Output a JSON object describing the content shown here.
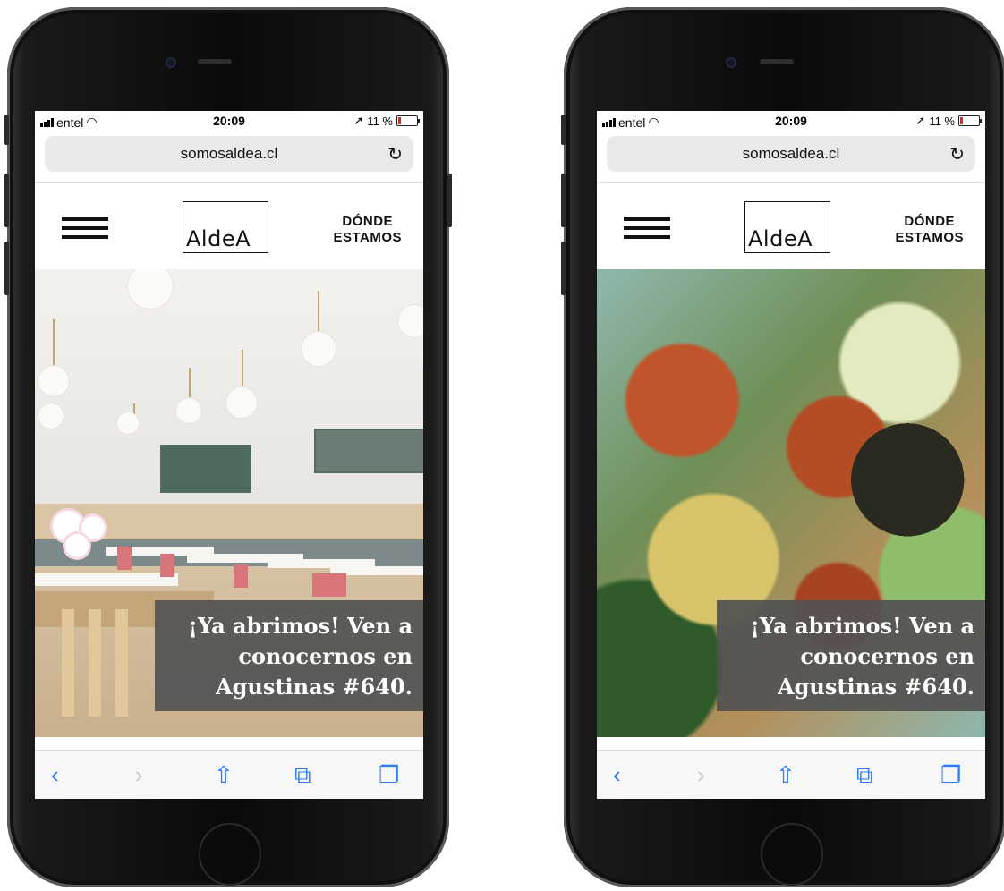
{
  "phones": [
    {
      "status": {
        "carrier": "entel",
        "time": "20:09",
        "battery": "11 %"
      },
      "browser": {
        "url": "somosaldea.cl"
      },
      "site": {
        "logo": "AldeA",
        "donde_line1": "DÓNDE",
        "donde_line2": "ESTAMOS",
        "caption_line1": "¡Ya abrimos! Ven a",
        "caption_line2": "conocernos en",
        "caption_line3": "Agustinas #640."
      }
    },
    {
      "status": {
        "carrier": "entel",
        "time": "20:09",
        "battery": "11 %"
      },
      "browser": {
        "url": "somosaldea.cl"
      },
      "site": {
        "logo": "AldeA",
        "donde_line1": "DÓNDE",
        "donde_line2": "ESTAMOS",
        "caption_line1": "¡Ya abrimos! Ven a",
        "caption_line2": "conocernos en",
        "caption_line3": "Agustinas #640."
      }
    }
  ],
  "icons": {
    "back": "chevron-left-icon",
    "forward": "chevron-right-icon",
    "share": "share-icon",
    "bookmarks": "book-icon",
    "tabs": "tabs-icon",
    "reload": "reload-icon",
    "menu": "hamburger-menu-icon"
  },
  "colors": {
    "accent": "#2b7cf7",
    "caption_bg": "#525252",
    "battery_low": "#e0261e"
  }
}
